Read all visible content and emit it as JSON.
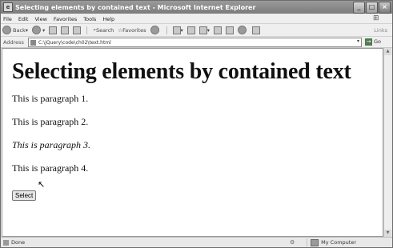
{
  "window": {
    "title": "Selecting elements by contained text - Microsoft Internet Explorer",
    "buttons": {
      "minimize": "_",
      "maximize": "□",
      "close": "×"
    }
  },
  "menu": {
    "items": [
      "File",
      "Edit",
      "View",
      "Favorites",
      "Tools",
      "Help"
    ]
  },
  "toolbar": {
    "back_label": "Back",
    "search_label": "Search",
    "favorites_label": "Favorites",
    "links_label": "Links"
  },
  "address": {
    "label": "Address",
    "value": "C:\\jQuery\\code\\ch02\\text.html",
    "go_label": "Go"
  },
  "page": {
    "heading": "Selecting elements by contained text",
    "paragraphs": [
      "This is paragraph 1.",
      "This is paragraph 2.",
      "This is paragraph 3.",
      "This is paragraph 4."
    ],
    "button_label": "Select"
  },
  "status": {
    "text": "Done",
    "zone": "My Computer"
  }
}
